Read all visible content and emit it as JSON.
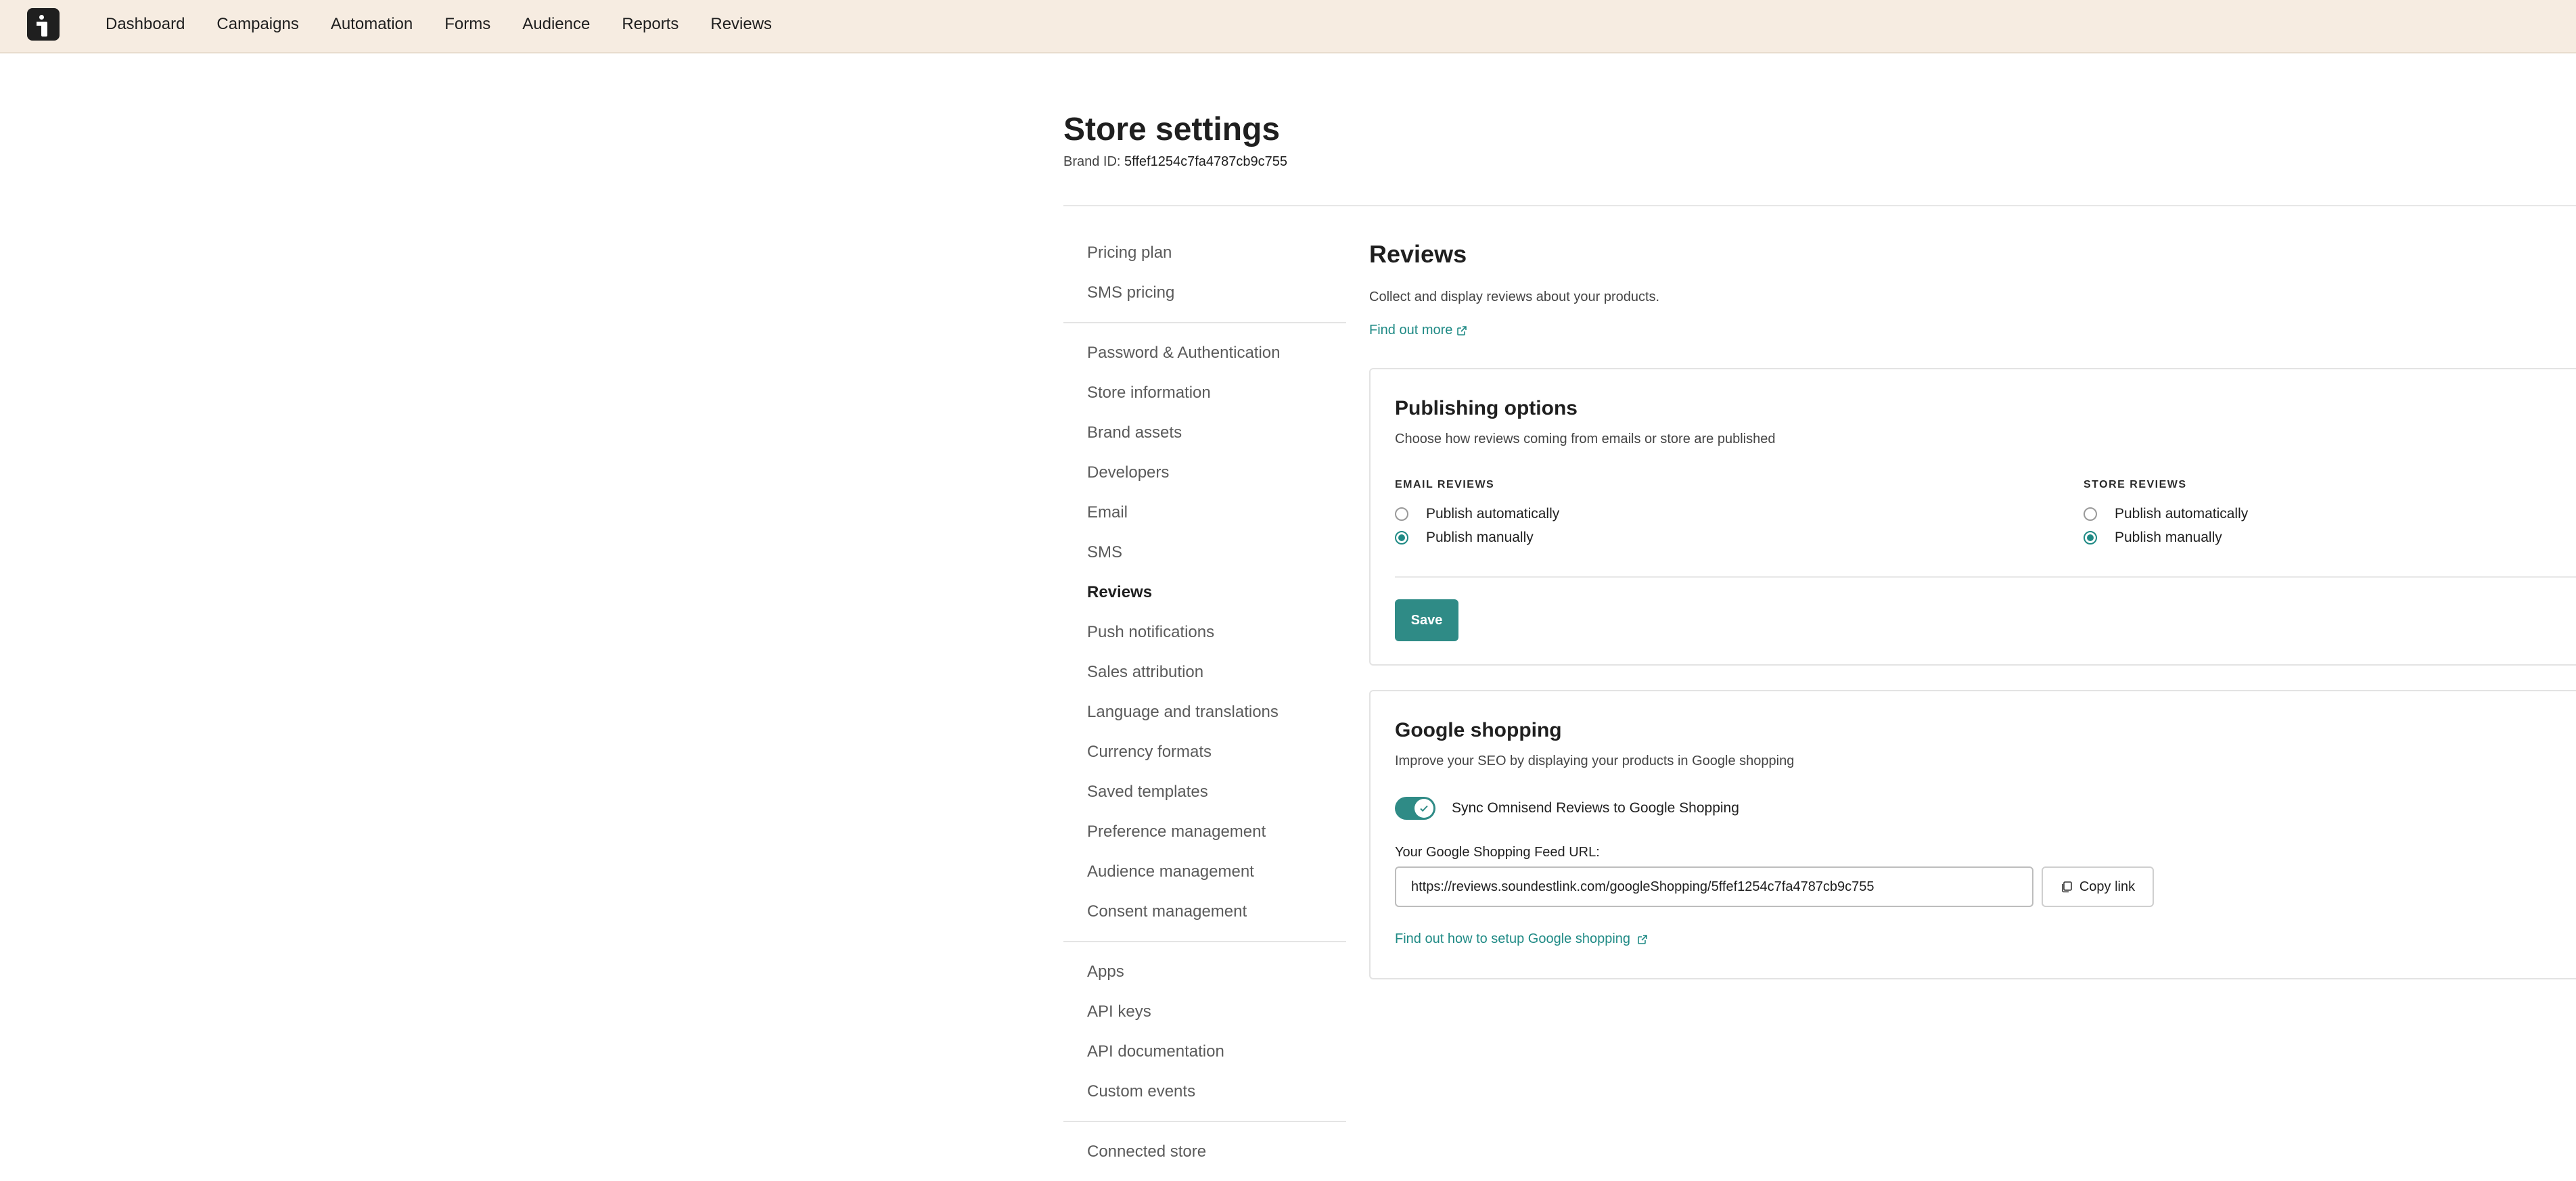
{
  "nav": {
    "items": [
      "Dashboard",
      "Campaigns",
      "Automation",
      "Forms",
      "Audience",
      "Reports",
      "Reviews"
    ]
  },
  "header": {
    "title": "Store settings",
    "brand_label": "Brand ID:",
    "brand_id": "5ffef1254c7fa4787cb9c755"
  },
  "sidebar": {
    "groups": [
      [
        "Pricing plan",
        "SMS pricing"
      ],
      [
        "Password & Authentication",
        "Store information",
        "Brand assets",
        "Developers",
        "Email",
        "SMS",
        "Reviews",
        "Push notifications",
        "Sales attribution",
        "Language and translations",
        "Currency formats",
        "Saved templates",
        "Preference management",
        "Audience management",
        "Consent management"
      ],
      [
        "Apps",
        "API keys",
        "API documentation",
        "Custom events"
      ],
      [
        "Connected store"
      ]
    ],
    "active": "Reviews"
  },
  "reviews": {
    "title": "Reviews",
    "description": "Collect and display reviews about your products.",
    "find_out_more": "Find out more"
  },
  "publishing": {
    "title": "Publishing options",
    "description": "Choose how reviews coming from emails or store are published",
    "email": {
      "label": "EMAIL REVIEWS",
      "options": [
        "Publish automatically",
        "Publish manually"
      ],
      "selected": "Publish manually"
    },
    "store": {
      "label": "STORE REVIEWS",
      "options": [
        "Publish automatically",
        "Publish manually"
      ],
      "selected": "Publish manually"
    },
    "save_label": "Save"
  },
  "google_shopping": {
    "title": "Google shopping",
    "description": "Improve your SEO by displaying your products in Google shopping",
    "sync_label": "Sync Omnisend Reviews to Google Shopping",
    "sync_enabled": true,
    "feed_label": "Your Google Shopping Feed URL:",
    "feed_url": "https://reviews.soundestlink.com/googleShopping/5ffef1254c7fa4787cb9c755",
    "copy_label": "Copy link",
    "setup_link": "Find out how to setup Google shopping"
  },
  "colors": {
    "accent": "#2f8b86",
    "link": "#1f8a85",
    "topbar": "#f6ece1"
  }
}
